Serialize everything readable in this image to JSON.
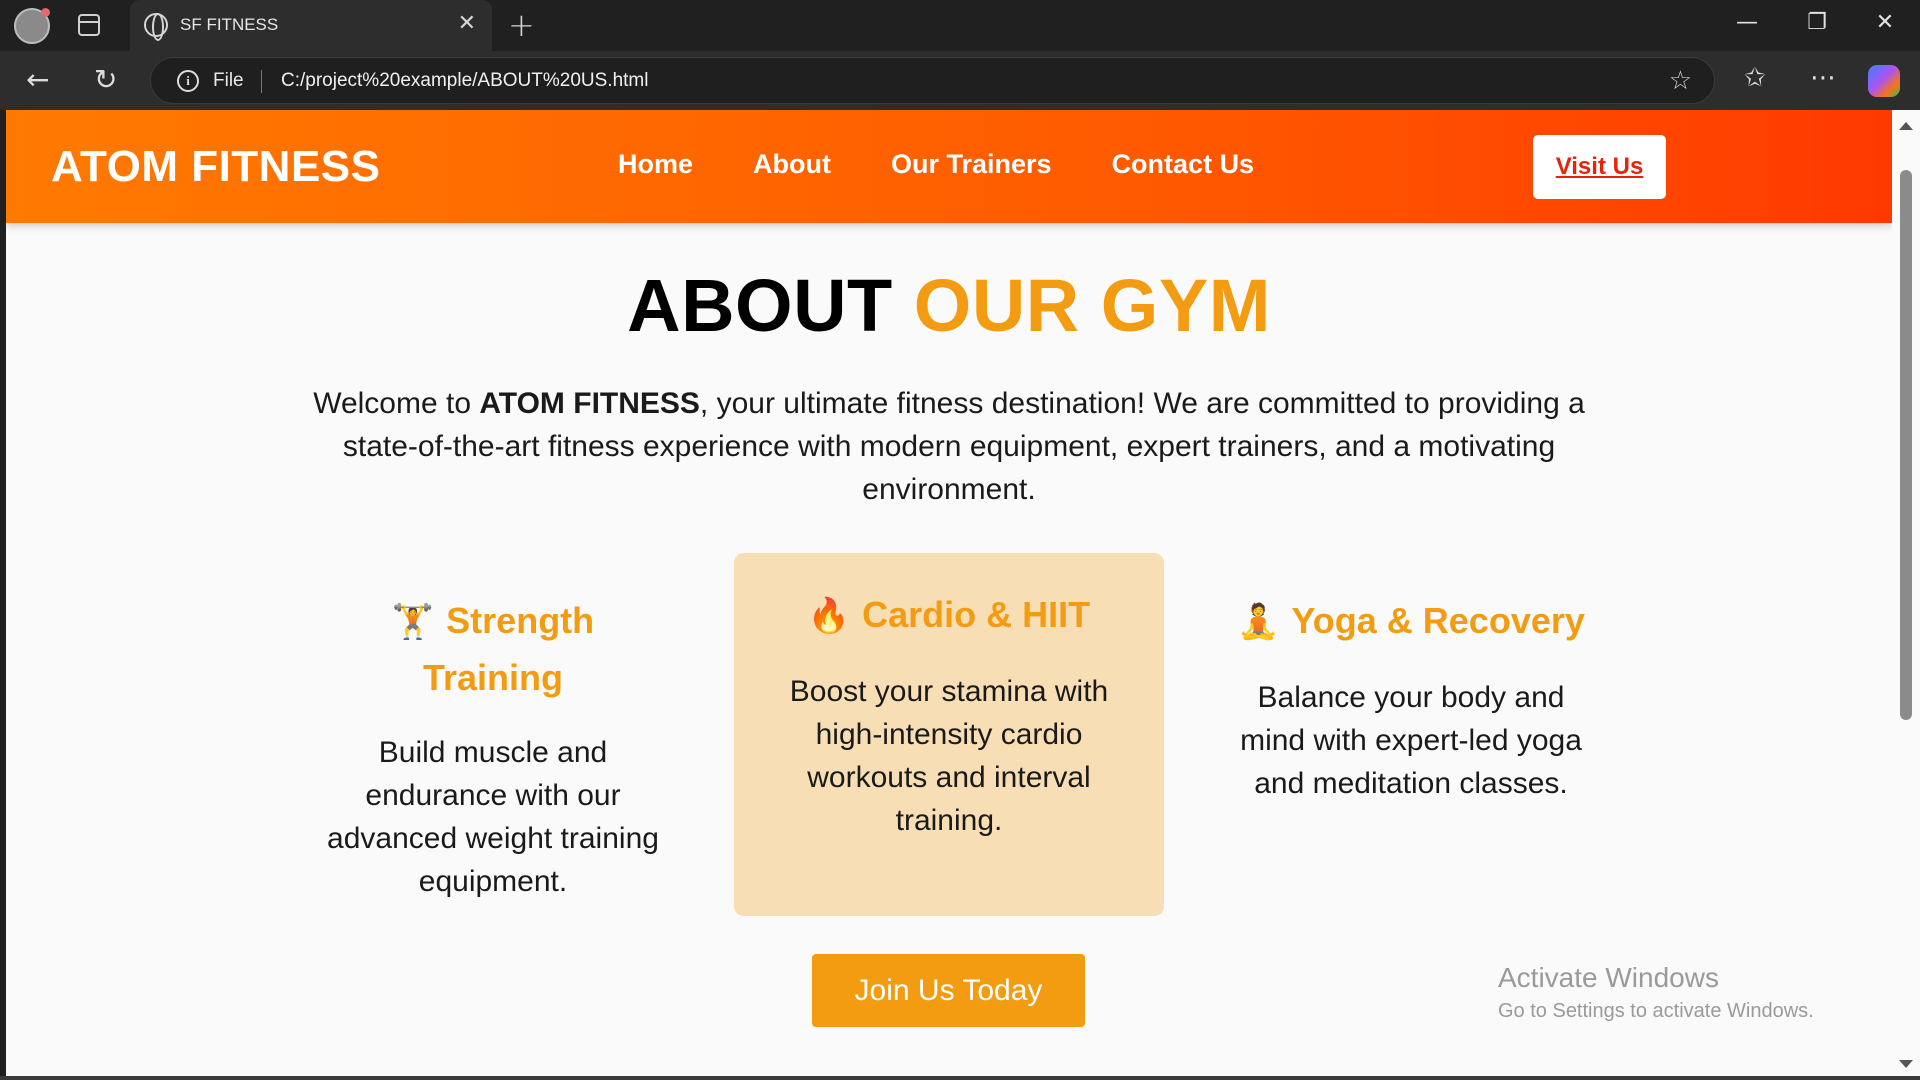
{
  "browser": {
    "tab_title": "SF FITNESS",
    "address_scheme_label": "File",
    "url": "C:/project%20example/ABOUT%20US.html",
    "icons": [
      "profile-icon",
      "tab-actions-icon",
      "globe-icon",
      "close-icon",
      "new-tab-icon",
      "minimize-icon",
      "restore-icon",
      "window-close-icon",
      "back-icon",
      "reload-icon",
      "info-icon",
      "favorite-star-icon",
      "favorites-icon",
      "more-icon",
      "copilot-icon"
    ]
  },
  "site": {
    "logo": "ATOM FITNESS",
    "nav": [
      "Home",
      "About",
      "Our Trainers",
      "Contact Us"
    ],
    "visit_button": "Visit Us",
    "heading_dark": "ABOUT",
    "heading_accent": "OUR GYM",
    "intro_before": "Welcome to ",
    "intro_bold": "ATOM FITNESS",
    "intro_after": ", your ultimate fitness destination! We are committed to providing a state-of-the-art fitness experience with modern equipment, expert trainers, and a motivating environment.",
    "cards": [
      {
        "icon": "🏋️",
        "title": "Strength Training",
        "desc": "Build muscle and endurance with our advanced weight training equipment."
      },
      {
        "icon": "🔥",
        "title": "Cardio & HIIT",
        "desc": "Boost your stamina with high-intensity cardio workouts and interval training."
      },
      {
        "icon": "🧘",
        "title": "Yoga & Recovery",
        "desc": "Balance your body and mind with expert-led yoga and meditation classes."
      }
    ],
    "join_button": "Join Us Today",
    "accent_color": "#f39c12",
    "header_gradient": [
      "#ff7a00",
      "#ff3a00"
    ]
  },
  "os_overlay": {
    "line1": "Activate Windows",
    "line2": "Go to Settings to activate Windows."
  }
}
